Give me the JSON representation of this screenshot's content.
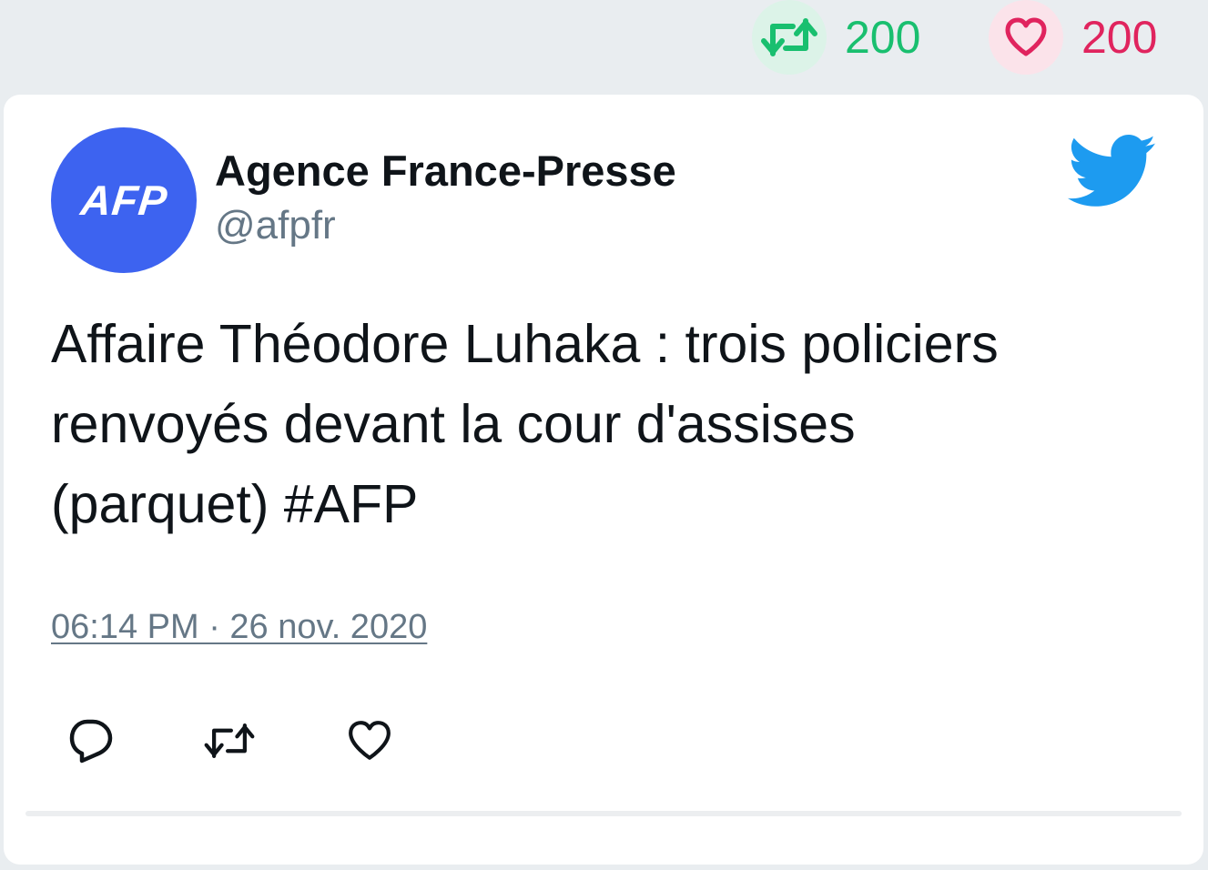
{
  "header_stats": {
    "retweets": "200",
    "likes": "200"
  },
  "tweet": {
    "avatar_text": "AFP",
    "author_name": "Agence France-Presse",
    "author_handle": "@afpfr",
    "text_lines": [
      "Affaire Théodore Luhaka : trois policiers",
      "renvoyés devant la cour d'assises",
      "(parquet) #AFP"
    ],
    "timestamp": "06:14 PM · 26 nov. 2020"
  },
  "icons": {
    "retweet": "retweet-icon",
    "like": "heart-icon",
    "reply": "reply-icon",
    "brand": "twitter-bird-icon"
  },
  "colors": {
    "background": "#e9edf0",
    "card": "#ffffff",
    "retweet_green": "#19bf6f",
    "like_pink": "#e0245e",
    "twitter_blue": "#1d9bf0",
    "avatar_blue": "#3d63f0",
    "text": "#0f1419",
    "secondary_text": "#657786"
  }
}
